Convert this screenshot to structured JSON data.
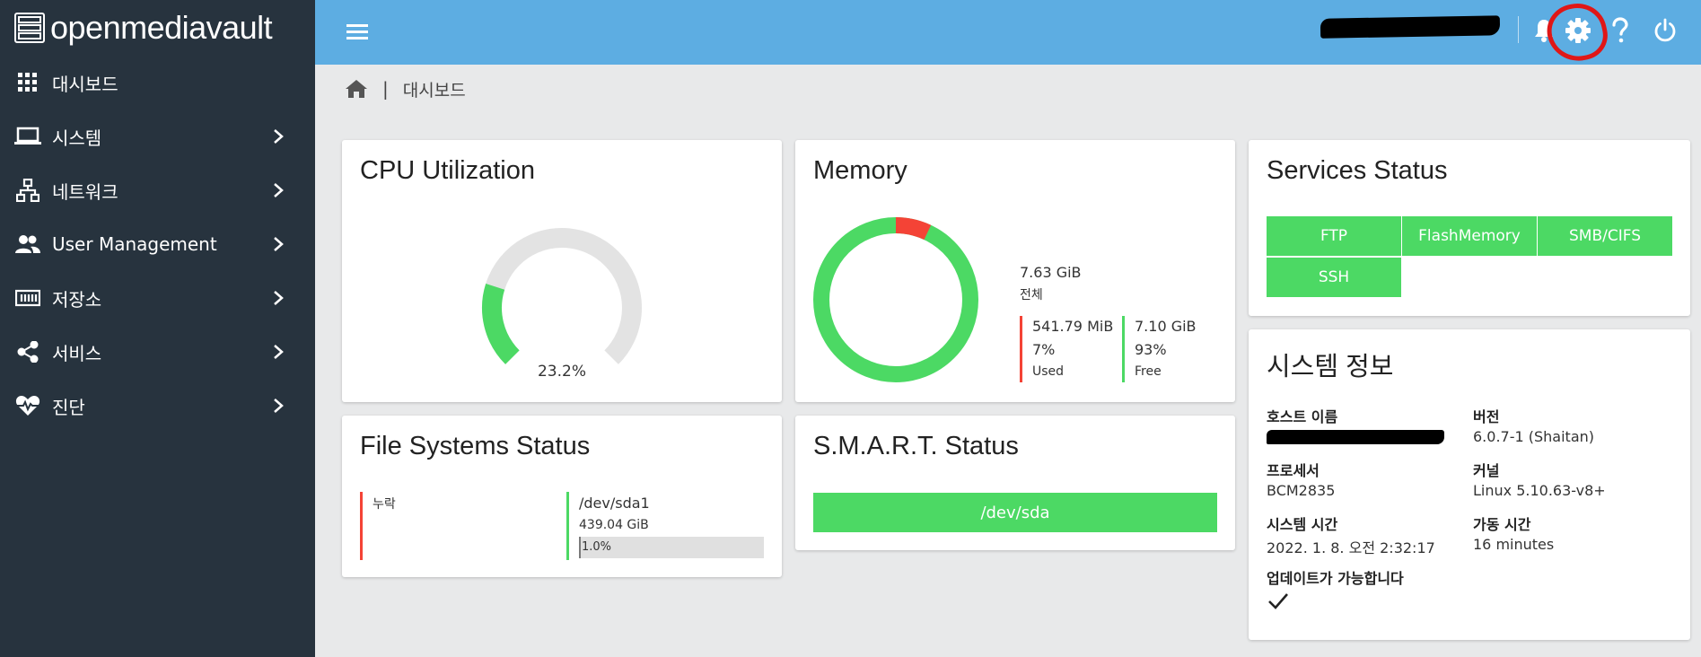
{
  "brand": {
    "name": "openmediavault"
  },
  "sidebar": {
    "items": [
      {
        "label": "대시보드",
        "icon": "dashboard-grid-icon"
      },
      {
        "label": "시스템",
        "icon": "laptop-icon"
      },
      {
        "label": "네트워크",
        "icon": "network-icon"
      },
      {
        "label": "User Management",
        "icon": "users-icon"
      },
      {
        "label": "저장소",
        "icon": "storage-icon"
      },
      {
        "label": "서비스",
        "icon": "share-icon"
      },
      {
        "label": "진단",
        "icon": "heart-pulse-icon"
      }
    ]
  },
  "topbar": {
    "icons": [
      "menu-icon",
      "bell-icon",
      "gear-icon",
      "help-icon",
      "power-icon"
    ]
  },
  "breadcrumb": {
    "label": "대시보드"
  },
  "cpu": {
    "title": "CPU Utilization",
    "value": "23.2%",
    "percent": 23.2
  },
  "memory": {
    "title": "Memory",
    "total_value": "7.63 GiB",
    "total_label": "전체",
    "used_value": "541.79 MiB",
    "used_percent": "7%",
    "used_label": "Used",
    "free_value": "7.10 GiB",
    "free_percent": "93%",
    "free_label": "Free",
    "used_fraction": 0.07
  },
  "services": {
    "title": "Services Status",
    "items": [
      "FTP",
      "FlashMemory",
      "SMB/CIFS",
      "SSH"
    ]
  },
  "sysinfo": {
    "title": "시스템 정보",
    "hostname_label": "호스트 이름",
    "version_label": "버전",
    "version_value": "6.0.7-1 (Shaitan)",
    "processor_label": "프로세서",
    "processor_value": "BCM2835",
    "kernel_label": "커널",
    "kernel_value": "Linux 5.10.63-v8+",
    "time_label": "시스템 시간",
    "time_value": "2022. 1. 8. 오전 2:32:17",
    "uptime_label": "가동 시간",
    "uptime_value": "16 minutes",
    "updates_label": "업데이트가 가능합니다"
  },
  "filesystems": {
    "title": "File Systems Status",
    "missing_label": "누락",
    "device": "/dev/sda1",
    "size": "439.04 GiB",
    "usage": "1.0%",
    "usage_fraction": 0.01
  },
  "smart": {
    "title": "S.M.A.R.T. Status",
    "device": "/dev/sda"
  },
  "colors": {
    "sidebar": "#27333e",
    "topbar": "#5dade2",
    "green": "#4cd964",
    "red": "#f44336"
  }
}
